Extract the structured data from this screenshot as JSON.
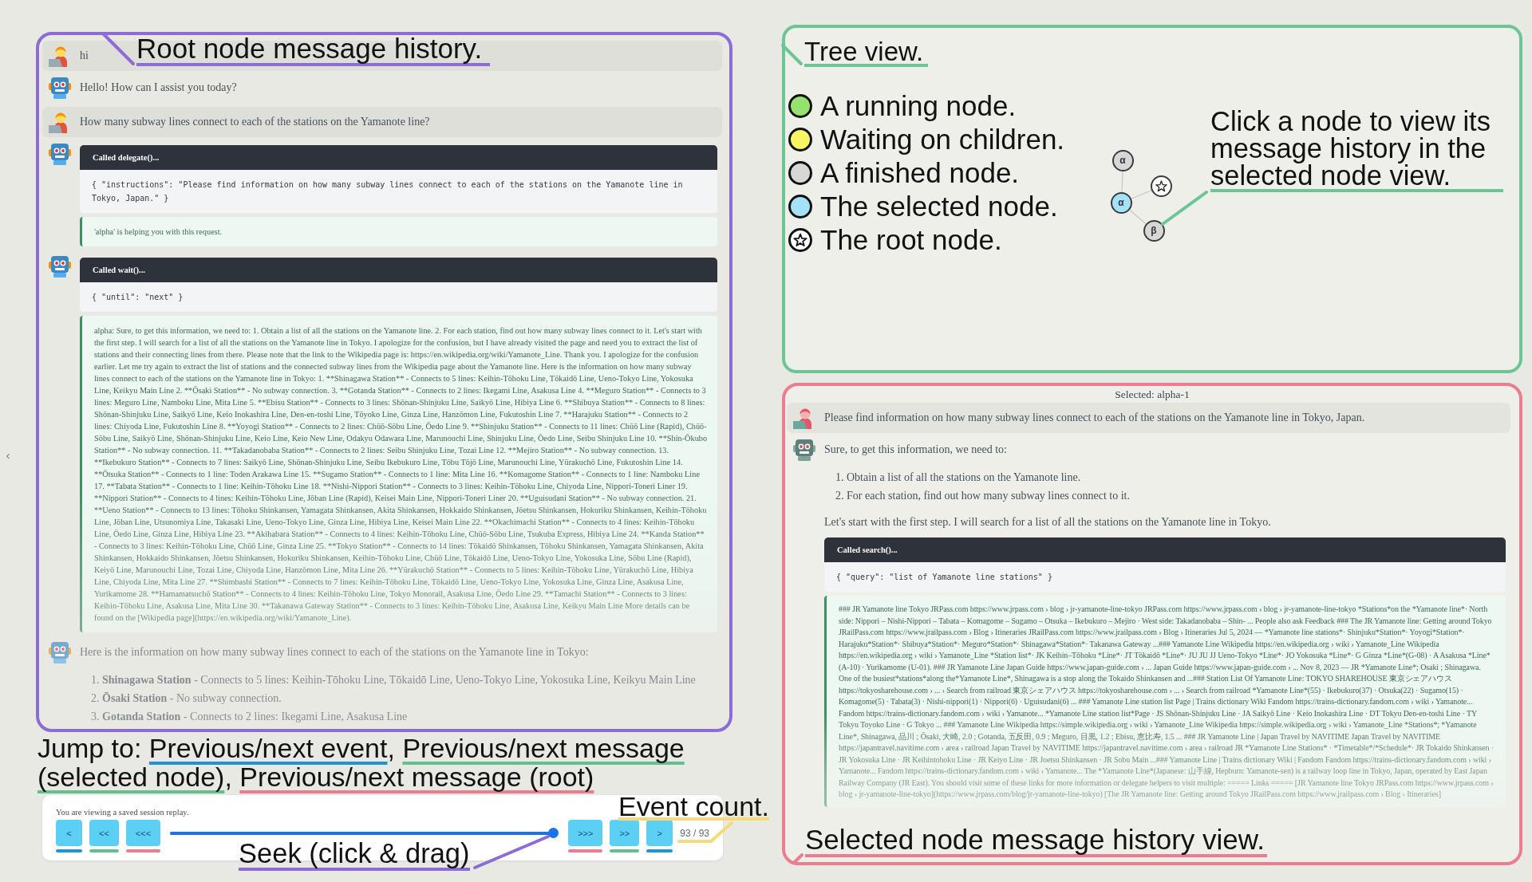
{
  "collapse_toggle": "‹",
  "root_history": {
    "annotation": "Root node message history.",
    "messages": [
      {
        "kind": "user",
        "blocks": [
          {
            "kind": "paragraph",
            "text": "hi"
          }
        ]
      },
      {
        "kind": "assistant",
        "blocks": [
          {
            "kind": "paragraph",
            "text": "Hello! How can I assist you today?"
          }
        ]
      },
      {
        "kind": "user",
        "blocks": [
          {
            "kind": "paragraph",
            "text": "How many subway lines connect to each of the stations on the Yamanote line?"
          }
        ]
      },
      {
        "kind": "assistant",
        "blocks": [
          {
            "kind": "tool_call",
            "title": "Called delegate()...",
            "arguments": "{ \"instructions\": \"Please find information on how many subway lines connect to each of the stations on the Yamanote line in Tokyo, Japan.\" }",
            "result": "'alpha' is helping you with this request."
          }
        ]
      },
      {
        "kind": "assistant",
        "blocks": [
          {
            "kind": "tool_call",
            "title": "Called wait()...",
            "arguments": "{ \"until\": \"next\" }",
            "result": "alpha: Sure, to get this information, we need to: 1. Obtain a list of all the stations on the Yamanote line. 2. For each station, find out how many subway lines connect to it. Let's start with the first step. I will search for a list of all the stations on the Yamanote line in Tokyo. I apologize for the confusion, but I have already visited the page and need you to extract the list of stations and their connecting lines from there. Please note that the link to the Wikipedia page is: https://en.wikipedia.org/wiki/Yamanote_Line. Thank you. I apologize for the confusion earlier. Let me try again to extract the list of stations and the connected subway lines from the Wikipedia page about the Yamanote line. Here is the information on how many subway lines connect to each of the stations on the Yamanote line in Tokyo: 1. **Shinagawa Station** - Connects to 5 lines: Keihin-Tōhoku Line, Tōkaidō Line, Ueno-Tokyo Line, Yokosuka Line, Keikyu Main Line 2. **Ōsaki Station** - No subway connection. 3. **Gotanda Station** - Connects to 2 lines: Ikegami Line, Asakusa Line 4. **Meguro Station** - Connects to 3 lines: Meguro Line, Namboku Line, Mita Line 5. **Ebisu Station** - Connects to 3 lines: Shōnan-Shinjuku Line, Saikyō Line, Hibiya Line 6. **Shibuya Station** - Connects to 8 lines: Shōnan-Shinjuku Line, Saikyō Line, Keio Inokashira Line, Den-en-toshi Line, Tōyoko Line, Ginza Line, Hanzōmon Line, Fukutoshin Line 7. **Harajuku Station** - Connects to 2 lines: Chiyoda Line, Fukutoshin Line 8. **Yoyogi Station** - Connects to 2 lines: Chūō-Sōbu Line, Ōedo Line 9. **Shinjuku Station** - Connects to 11 lines: Chūō Line (Rapid), Chūō-Sōbu Line, Saikyō Line, Shōnan-Shinjuku Line, Keio Line, Keio New Line, Odakyu Odawara Line, Marunouchi Line, Shinjuku Line, Ōedo Line, Seibu Shinjuku Line 10. **Shin-Ōkubo Station** - No subway connection. 11. **Takadanobaba Station** - Connects to 2 lines: Seibu Shinjuku Line, Tozai Line 12. **Mejiro Station** - No subway connection. 13. **Ikebukuro Station** - Connects to 7 lines: Saikyō Line, Shōnan-Shinjuku Line, Seibu Ikebukuro Line, Tōbu Tōjō Line, Marunouchi Line, Yūrakuchō Line, Fukutoshin Line 14. **Ōtsuka Station** - Connects to 1 line: Toden Arakawa Line 15. **Sugamo Station** - Connects to 1 line: Mita Line 16. **Komagome Station** - Connects to 1 line: Namboku Line 17. **Tabata Station** - Connects to 1 line: Keihin-Tōhoku Line 18. **Nishi-Nippori Station** - Connects to 3 lines: Keihin-Tōhoku Line, Chiyoda Line, Nippori-Toneri Liner 19. **Nippori Station** - Connects to 4 lines: Keihin-Tōhoku Line, Jōban Line (Rapid), Keisei Main Line, Nippori-Toneri Liner 20. **Uguisudani Station** - No subway connection. 21. **Ueno Station** - Connects to 13 lines: Tōhoku Shinkansen, Yamagata Shinkansen, Akita Shinkansen, Hokkaido Shinkansen, Jōetsu Shinkansen, Hokuriku Shinkansen, Keihin-Tōhoku Line, Jōban Line, Utsunomiya Line, Takasaki Line, Ueno-Tokyo Line, Ginza Line, Hibiya Line, Keisei Main Line 22. **Okachimachi Station** - Connects to 4 lines: Keihin-Tōhoku Line, Ōedo Line, Ginza Line, Hibiya Line 23. **Akihabara Station** - Connects to 4 lines: Keihin-Tōhoku Line, Chūō-Sōbu Line, Tsukuba Express, Hibiya Line 24. **Kanda Station** - Connects to 3 lines: Keihin-Tōhoku Line, Chūō Line, Ginza Line 25. **Tokyo Station** - Connects to 14 lines: Tōkaidō Shinkansen, Tōhoku Shinkansen, Yamagata Shinkansen, Akita Shinkansen, Hokkaido Shinkansen, Jōetsu Shinkansen, Hokuriku Shinkansen, Keihin-Tōhoku Line, Chūō Line, Tōkaidō Line, Ueno-Tokyo Line, Yokosuka Line, Sōbu Line (Rapid), Keiyō Line, Marunouchi Line, Tozai Line, Chiyoda Line, Hanzōmon Line, Mita Line 26. **Yūrakuchō Station** - Connects to 5 lines: Keihin-Tōhoku Line, Yūrakuchō Line, Hibiya Line, Chiyoda Line, Mita Line 27. **Shimbashi Station** - Connects to 7 lines: Keihin-Tōhoku Line, Tōkaidō Line, Ueno-Tokyo Line, Yokosuka Line, Ginza Line, Asakusa Line, Yurikamome 28. **Hamamatsuchō Station** - Connects to 4 lines: Keihin-Tōhoku Line, Tokyo Monorail, Asakusa Line, Ōedo Line 29. **Tamachi Station** - Connects to 3 lines: Keihin-Tōhoku Line, Asakusa Line, Mita Line 30. **Takanawa Gateway Station** - Connects to 3 lines: Keihin-Tōhoku Line, Asakusa Line, Keikyu Main Line More details can be found on the [Wikipedia page](https://en.wikipedia.org/wiki/Yamanote_Line)."
          }
        ]
      },
      {
        "kind": "assistant",
        "blocks": [
          {
            "kind": "paragraph",
            "text": "Here is the information on how many subway lines connect to each of the stations on the Yamanote line in Tokyo:"
          },
          {
            "kind": "list",
            "items": [
              {
                "number": "1.",
                "text": "**Shinagawa Station** - Connects to 5 lines: Keihin-Tōhoku Line, Tōkaidō Line, Ueno-Tokyo Line, Yokosuka Line, Keikyu Main Line"
              },
              {
                "number": "2.",
                "text": "**Ōsaki Station** - No subway connection."
              },
              {
                "number": "3.",
                "text": "**Gotanda Station** - Connects to 2 lines: Ikegami Line, Asakusa Line"
              }
            ]
          }
        ]
      }
    ]
  },
  "player": {
    "annotation": [
      {
        "text": "Jump to: "
      },
      {
        "text": "Previous/next event",
        "color": "#1f93d6"
      },
      {
        "text": ", "
      },
      {
        "text": "Previous/next message (selected node)",
        "color": "#63c08e"
      },
      {
        "text": ", "
      },
      {
        "text": "Previous/next message (root)",
        "color": "#ea7d90"
      }
    ],
    "notice": "You are viewing a saved session replay.",
    "back_buttons": [
      {
        "label": "<",
        "color": "#1f93d6"
      },
      {
        "label": "<<",
        "color": "#63c08e"
      },
      {
        "label": "<<<",
        "color": "#ea7d90"
      }
    ],
    "seek": {
      "level": 1,
      "annotation": "Seek (click & drag)"
    },
    "forward_buttons": [
      {
        "label": ">>>",
        "color": "#ea7d90"
      },
      {
        "label": ">>",
        "color": "#63c08e"
      },
      {
        "label": ">",
        "color": "#1f93d6"
      }
    ],
    "count": "93 / 93",
    "count_annotation": "Event count."
  },
  "tree": {
    "annotation": "Tree view.",
    "legend": [
      {
        "kind": "running",
        "color": "#95e36e",
        "label": "A running node."
      },
      {
        "kind": "waiting",
        "color": "#f8f662",
        "label": "Waiting on children."
      },
      {
        "kind": "finished",
        "color": "#d7d7d7",
        "label": "A finished node."
      },
      {
        "kind": "selected",
        "color": "#a6e2f7",
        "label": "The selected node."
      },
      {
        "kind": "root",
        "label": "The root node."
      }
    ],
    "root": {
      "kind": "root",
      "selected": false,
      "children": [
        {
          "label": "α",
          "selected": true,
          "children": [
            {
              "kind": "finished",
              "label": "α",
              "selected": false
            },
            {
              "kind": "finished",
              "label": "β",
              "selected": false
            }
          ]
        }
      ]
    },
    "hint": "Click a node to view its message history in the selected node view."
  },
  "selected_history": {
    "title": "Selected: alpha-1",
    "annotation": "Selected node message history view.",
    "messages": [
      {
        "kind": "user",
        "blocks": [
          {
            "kind": "paragraph",
            "text": "Please find information on how many subway lines connect to each of the stations on the Yamanote line in Tokyo, Japan."
          }
        ]
      },
      {
        "kind": "assistant",
        "blocks": [
          {
            "kind": "paragraph",
            "text": "Sure, to get this information, we need to:"
          },
          {
            "kind": "list",
            "items": [
              {
                "number": "1.",
                "text": "Obtain a list of all the stations on the Yamanote line."
              },
              {
                "number": "2.",
                "text": "For each station, find out how many subway lines connect to it."
              }
            ]
          },
          {
            "kind": "paragraph",
            "text": "Let's start with the first step. I will search for a list of all the stations on the Yamanote line in Tokyo."
          },
          {
            "kind": "tool_call",
            "title": "Called search()...",
            "arguments": "{ \"query\": \"list of Yamanote line stations\" }",
            "result": "### JR Yamanote line Tokyo JRPass.com https://www.jrpass.com › blog › jr-yamanote-line-tokyo JRPass.com https://www.jrpass.com › blog › jr-yamanote-line-tokyo *Stations*on the *Yamanote line*· North side: Nippori – Nishi-Nippori – Tabata – Komagome – Sugamo – Otsuka – Ikebukuro – Mejiro · West side: Takadanobaba – Shin- ... People also ask Feedback ### The JR Yamanote line: Getting around Tokyo JRailPass.com https://www.jrailpass.com › Blog › Itineraries JRailPass.com https://www.jrailpass.com › Blog › Itineraries Jul 5, 2024 — *Yamanote line stations*· Shinjuku*Station*· Yoyogi*Station*· Harajuku*Station*· Shibuya*Station*· Meguro*Station*· Shinagawa*Station*· Takanawa Gateway ...### Yamanote Line Wikipedia https://en.wikipedia.org › wiki › Yamanote_Line Wikipedia https://en.wikipedia.org › wiki › Yamanote_Line *Station list*· JK Keihin–Tōhoku *Line*· JT Tōkaidō *Line*· JU JU JJ Ueno-Tokyo *Line*· JO Yokosuka *Line*· G Ginza *Line*(G-08) · A Asakusa *Line*(A-10) · Yurikamome (U-01). ### JR Yamanote Line Japan Guide https://www.japan-guide.com › ... Japan Guide https://www.japan-guide.com › ... Nov 8, 2023 — JR *Yamanote Line*; Osaki ; Shinagawa. One of the busiest*stations*along the*Yamanote Line*, Shinagawa is a stop along the Tokaido Shinkansen and ...### Station List Of Yamanote Line: TOKYO SHAREHOUSE 東京シェアハウス https://tokyosharehouse.com › ... › Search from railroad 東京シェアハウス https://tokyosharehouse.com › ... › Search from railroad *Yamanote Line*(55) · Ikebukuro(37) · Otsuka(22) · Sugamo(15) · Komagome(5) · Tabata(3) · Nishi-nippori(1) · Nippori(6) · Uguisudani(6) ... ### Yamanote Line station list Page | Trains dictionary Wiki Fandom https://trains-dictionary.fandom.com › wiki › Yamanote... Fandom https://trains-dictionary.fandom.com › wiki › Yamanote... *Yamanote Line station list*Page · JS Shōnan-Shinjuku Line · JA Saikyō Line · Keio Inokashira Line · DT Tokyu Den-en-toshi Line · TY Tokyu Toyoko Line · G Tokyo ... ### Yamanote Line Wikipedia https://simple.wikipedia.org › wiki › Yamanote_Line Wikipedia https://simple.wikipedia.org › wiki › Yamanote_Line *Stations*; *Yamanote Line*, Shinagawa, 品川 ; Ōsaki, 大崎, 2.0 ; Gotanda, 五反田, 0.9 ; Meguro, 目黒, 1.2 ; Ebisu, 恵比寿, 1.5 ... ### JR Yamanote Line | Japan Travel by NAVITIME Japan Travel by NAVITIME https://japantravel.navitime.com › area › railroad Japan Travel by NAVITIME https://japantravel.navitime.com › area › railroad JR *Yamanote Line Stations* · *Timetable*/*Schedule*· JR Tokaido Shinkansen · JR Yokosuka Line · JR Keihintohoku Line · JR Keiyo Line · JR Joetsu Shinkansen · JR Sobu Main ...### Yamanote Line | Trains dictionary Wiki | Fandom Fandom https://trains-dictionary.fandom.com › wiki › Yamanote... Fandom https://trains-dictionary.fandom.com › wiki › Yamanote... The *Yamanote Line*(Japanese: 山手線, Hepburn: Yamanote-sen) is a railway loop line in Tokyo, Japan, operated by East Japan Railway Company (JR East). You should visit some of these links for more information or delegate helpers to visit multiple: ===== Links ===== [JR Yamanote line Tokyo JRPass.com https://www.jrpass.com › blog › jr-yamanote-line-tokyo](https://www.jrpass.com/blog/jr-yamanote-line-tokyo) [The JR Yamanote line: Getting around Tokyo JRailPass.com https://www.jrailpass.com › Blog › Itineraries]"
          }
        ]
      }
    ]
  }
}
